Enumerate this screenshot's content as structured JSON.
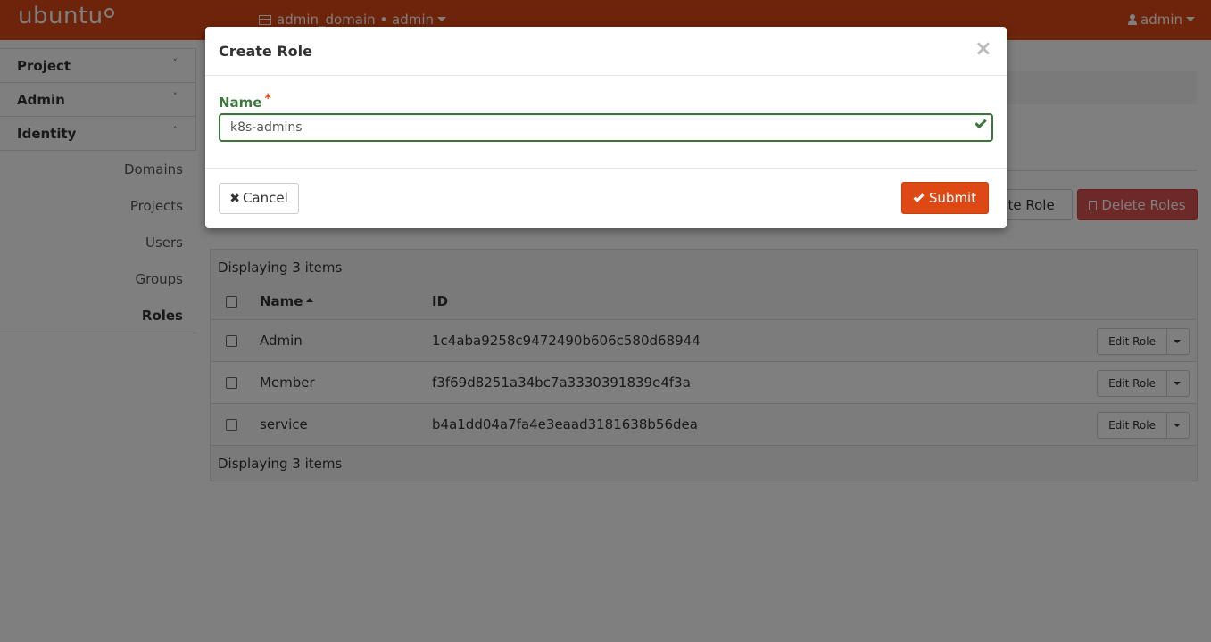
{
  "header": {
    "logo": "ubuntu",
    "context": "admin_domain • admin",
    "user": "admin"
  },
  "sidebar": {
    "sections": [
      {
        "label": "Project",
        "chevron": "˅"
      },
      {
        "label": "Admin",
        "chevron": "˅"
      },
      {
        "label": "Identity",
        "chevron": "˄"
      }
    ],
    "items": [
      {
        "label": "Domains"
      },
      {
        "label": "Projects"
      },
      {
        "label": "Users"
      },
      {
        "label": "Groups"
      },
      {
        "label": "Roles"
      }
    ]
  },
  "actions": {
    "create_role": "ate Role",
    "delete_roles": "Delete Roles"
  },
  "table": {
    "count_text": "Displaying 3 items",
    "columns": {
      "name": "Name",
      "id": "ID"
    },
    "rows": [
      {
        "name": "Admin",
        "id": "1c4aba9258c9472490b606c580d68944",
        "action": "Edit Role"
      },
      {
        "name": "Member",
        "id": "f3f69d8251a34bc7a3330391839e4f3a",
        "action": "Edit Role"
      },
      {
        "name": "service",
        "id": "b4a1dd04a7fa4e3eaad3181638b56dea",
        "action": "Edit Role"
      }
    ]
  },
  "modal": {
    "title": "Create Role",
    "close": "×",
    "name_label": "Name",
    "required_mark": "*",
    "name_value": "k8s-admins",
    "cancel_label": "Cancel",
    "cancel_icon": "✖",
    "submit_label": "Submit"
  },
  "colors": {
    "brand": "#dd4814",
    "success": "#3c763d",
    "danger": "#d9534f"
  }
}
